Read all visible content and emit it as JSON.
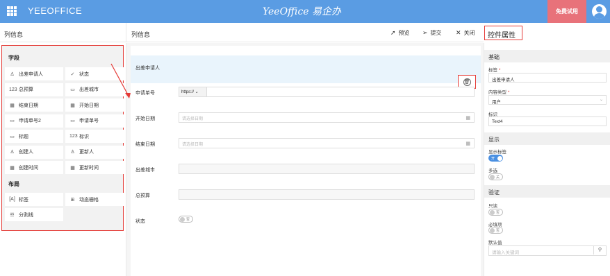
{
  "topbar": {
    "app_name": "YEEOFFICE",
    "logo_text": "YeeOffice 易企办",
    "trial_button": "免费试用"
  },
  "left_panel": {
    "title": "列信息",
    "fields_group": "字段",
    "fields": [
      {
        "label": "出差申请人",
        "icon": "person-icon",
        "glyph": "♙"
      },
      {
        "label": "状态",
        "icon": "check-circle-icon",
        "glyph": "✓"
      },
      {
        "label": "总预算",
        "icon": "number-icon",
        "glyph": "123"
      },
      {
        "label": "出差城市",
        "icon": "textbox-icon",
        "glyph": "▭"
      },
      {
        "label": "结束日期",
        "icon": "calendar-icon",
        "glyph": "▦"
      },
      {
        "label": "开始日期",
        "icon": "calendar-icon",
        "glyph": "▦"
      },
      {
        "label": "申请单号2",
        "icon": "textbox-icon",
        "glyph": "▭"
      },
      {
        "label": "申请单号",
        "icon": "textbox-icon",
        "glyph": "▭"
      },
      {
        "label": "标题",
        "icon": "textbox-icon",
        "glyph": "▭"
      },
      {
        "label": "标识",
        "icon": "number-icon",
        "glyph": "123"
      },
      {
        "label": "创建人",
        "icon": "person-icon",
        "glyph": "♙"
      },
      {
        "label": "更新人",
        "icon": "person-icon",
        "glyph": "♙"
      },
      {
        "label": "创建时间",
        "icon": "calendar-icon",
        "glyph": "▦"
      },
      {
        "label": "更新时间",
        "icon": "calendar-icon",
        "glyph": "▦"
      }
    ],
    "layout_group": "布局",
    "layout_items": [
      {
        "label": "标签",
        "icon": "label-icon",
        "glyph": "[A]"
      },
      {
        "label": "动态栅格",
        "icon": "grid-icon",
        "glyph": "⊞"
      },
      {
        "label": "分割线",
        "icon": "divider-icon",
        "glyph": "☲"
      }
    ]
  },
  "middle": {
    "title": "列信息",
    "toolbar": {
      "preview": "预览",
      "submit": "提交",
      "close": "关闭"
    },
    "selected_field": "出差申请人",
    "form": [
      {
        "label": "申请单号",
        "type": "url",
        "prefix": "https://"
      },
      {
        "label": "开始日期",
        "type": "date",
        "placeholder": "请选择日期"
      },
      {
        "label": "结束日期",
        "type": "date",
        "placeholder": "请选择日期"
      },
      {
        "label": "出差城市",
        "type": "text"
      },
      {
        "label": "总预算",
        "type": "text"
      },
      {
        "label": "状态",
        "type": "toggle",
        "toggle_text": "否"
      }
    ]
  },
  "right_panel": {
    "title": "控件属性",
    "basic": "基础",
    "label_label": "标签",
    "label_value": "出差申请人",
    "content_type_label": "内容类型",
    "content_type_value": "用户",
    "id_label": "标识",
    "id_value": "Text4",
    "display": "显示",
    "show_label": "显示标签",
    "show_label_toggle": "开",
    "multi": "多选",
    "multi_toggle": "关",
    "validation": "验证",
    "readonly": "只读",
    "readonly_toggle": "否",
    "required": "必填项",
    "required_toggle": "否",
    "default_label": "默认值",
    "default_placeholder": "请输入关键词"
  }
}
